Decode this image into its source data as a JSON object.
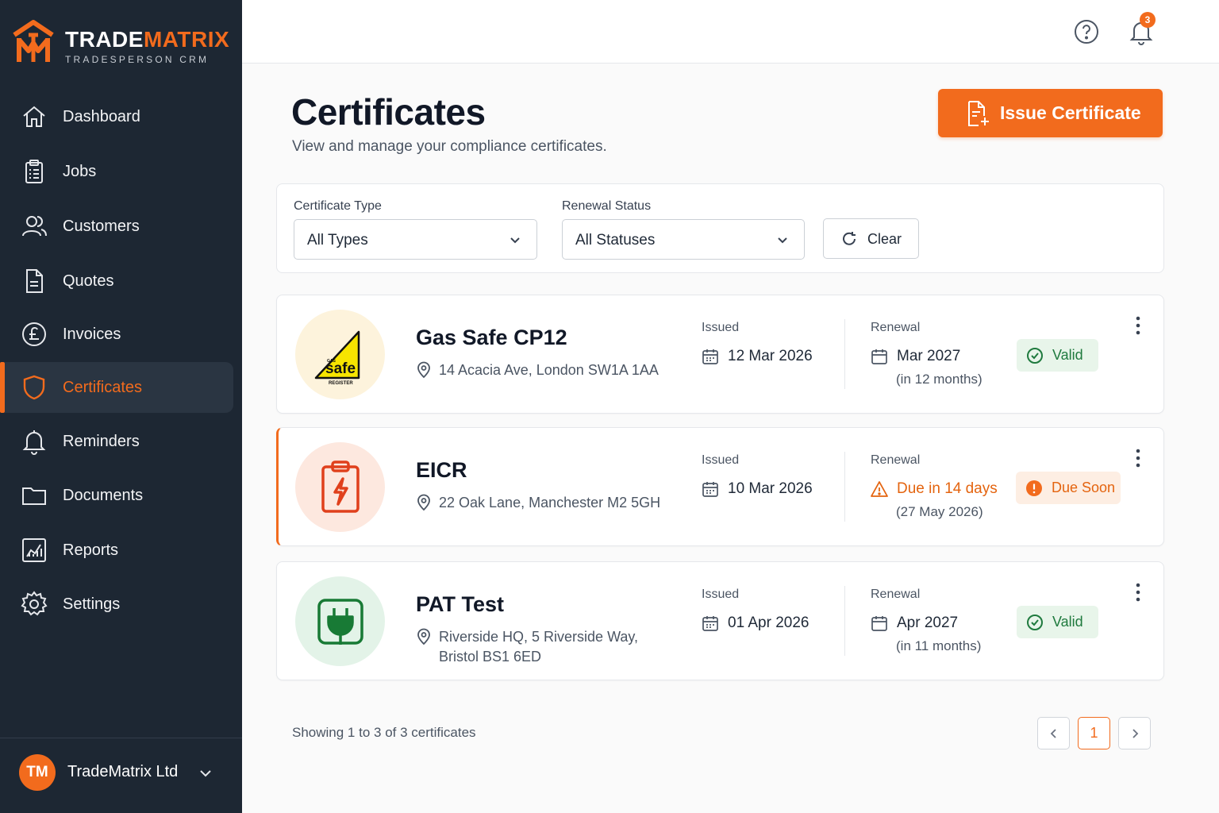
{
  "brand": {
    "name_part1": "TRADE",
    "name_part2": "MATRIX",
    "tagline": "TRADESPERSON CRM",
    "accent_color": "#f26b1d"
  },
  "sidebar": {
    "items": [
      {
        "label": "Dashboard",
        "icon": "home-icon"
      },
      {
        "label": "Jobs",
        "icon": "clipboard-icon"
      },
      {
        "label": "Customers",
        "icon": "users-icon"
      },
      {
        "label": "Quotes",
        "icon": "document-icon"
      },
      {
        "label": "Invoices",
        "icon": "pound-icon"
      },
      {
        "label": "Certificates",
        "icon": "shield-icon",
        "active": true
      },
      {
        "label": "Reminders",
        "icon": "bell-icon"
      },
      {
        "label": "Documents",
        "icon": "folder-icon"
      },
      {
        "label": "Reports",
        "icon": "chart-icon"
      },
      {
        "label": "Settings",
        "icon": "gear-icon"
      }
    ],
    "org": {
      "initials": "TM",
      "name": "TradeMatrix Ltd"
    }
  },
  "topbar": {
    "notification_count": "3"
  },
  "page": {
    "title": "Certificates",
    "subtitle": "View and manage your compliance certificates.",
    "issue_button": "Issue Certificate"
  },
  "filters": {
    "type_label": "Certificate Type",
    "type_value": "All Types",
    "status_label": "Renewal Status",
    "status_value": "All Statuses",
    "clear_label": "Clear"
  },
  "certificates": [
    {
      "name": "Gas Safe CP12",
      "address": "14 Acacia Ave, London SW1A 1AA",
      "issued_label": "Issued",
      "issued": "12 Mar 2026",
      "renewal_label": "Renewal",
      "renewal": "Mar 2027",
      "renewal_note": "(in 12 months)",
      "status": "Valid",
      "logo_text_top": "GAS",
      "logo_text_main": "safe",
      "logo_text_sub": "REGISTER"
    },
    {
      "name": "EICR",
      "address": "22 Oak Lane, Manchester M2 5GH",
      "issued_label": "Issued",
      "issued": "10 Mar 2026",
      "renewal_label": "Renewal",
      "renewal": "Due in 14 days",
      "renewal_note": "(27 May 2026)",
      "status": "Due Soon"
    },
    {
      "name": "PAT Test",
      "address_line1": "Riverside HQ, 5 Riverside Way,",
      "address_line2": "Bristol BS1 6ED",
      "issued_label": "Issued",
      "issued": "01 Apr 2026",
      "renewal_label": "Renewal",
      "renewal": "Apr 2027",
      "renewal_note": "(in 11 months)",
      "status": "Valid"
    }
  ],
  "footer": {
    "showing": "Showing 1 to 3 of 3 certificates",
    "current_page": "1"
  }
}
